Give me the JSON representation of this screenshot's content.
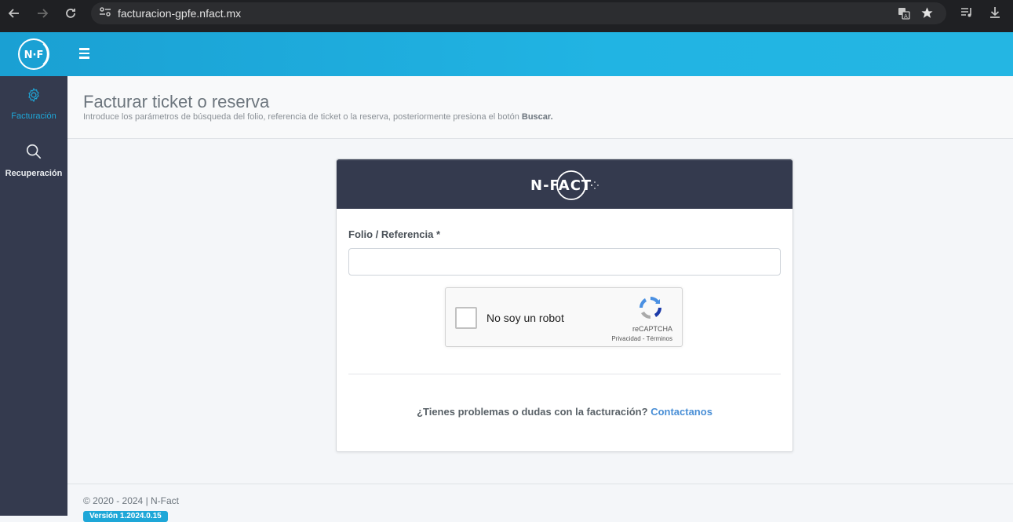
{
  "browser": {
    "url": "facturacion-gpfe.nfact.mx"
  },
  "header": {
    "logo_text": "N-F"
  },
  "sidebar": {
    "items": [
      {
        "label": "Facturación",
        "icon": "gear-icon",
        "active": true
      },
      {
        "label": "Recuperación",
        "icon": "search-icon",
        "active": false
      }
    ]
  },
  "page": {
    "title": "Facturar ticket o reserva",
    "description": "Introduce los parámetros de búsqueda del folio, referencia de ticket o la reserva, posteriormente presiona el botón",
    "description_bold": "Buscar."
  },
  "card": {
    "logo_text": "N-FACT",
    "field_label": "Folio / Referencia *",
    "field_value": "",
    "captcha": {
      "label": "No soy un robot",
      "brand": "reCAPTCHA",
      "links": "Privacidad - Términos"
    },
    "help_text": "¿Tienes problemas o dudas con la facturación?",
    "help_link": "Contactanos"
  },
  "footer": {
    "copyright": "© 2020 - 2024 | N-Fact",
    "version": "Versión 1.2024.0.15"
  },
  "colors": {
    "header": "#21b4e3",
    "sidebar": "#343a4e",
    "accent": "#1ea7d8",
    "link": "#4a8fd6"
  }
}
